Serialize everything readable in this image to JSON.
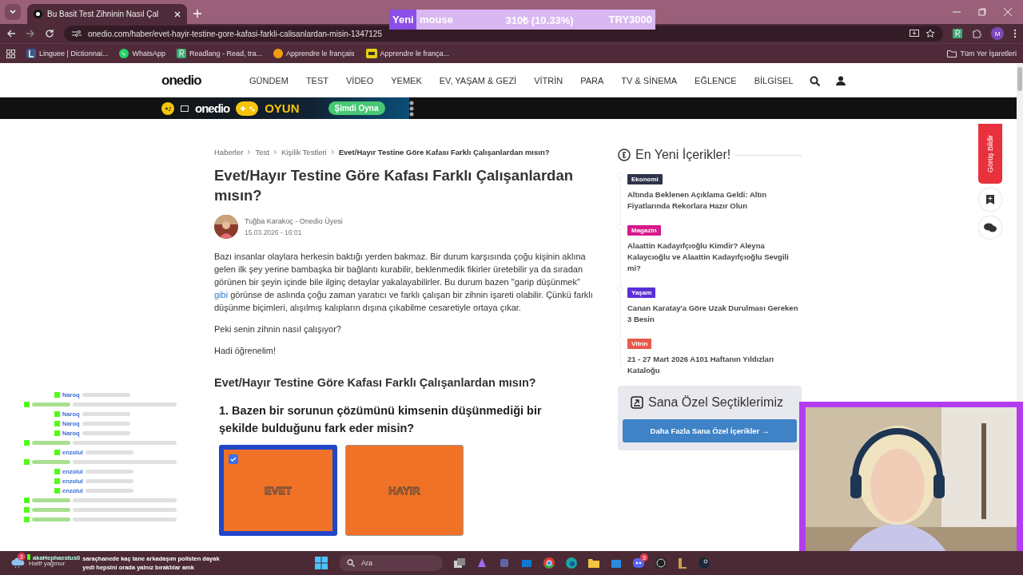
{
  "browser": {
    "tab_title": "Bu Basit Test Zihninin Nasıl Çal",
    "url": "onedio.com/haber/evet-hayir-testine-gore-kafasi-farkli-calisanlardan-misin-1347125",
    "bookmarks": [
      {
        "label": "Linguee | Dictionnai...",
        "kind": "letter"
      },
      {
        "label": "WhatsApp",
        "kind": "whatsapp"
      },
      {
        "label": "Readlang - Read, tra...",
        "kind": "r"
      },
      {
        "label": "Apprendre le français",
        "kind": "dot"
      },
      {
        "label": "Apprendre le frança...",
        "kind": "tile"
      }
    ],
    "all_bookmarks": "Tüm Yer İşaretleri",
    "profile": "M"
  },
  "goal": {
    "tag": "Yeni",
    "item": "mouse",
    "progress": "310₺ (10.33%)",
    "target": "TRY3000",
    "level": 0.1033
  },
  "site": {
    "logo": "onedio",
    "nav": [
      "GÜNDEM",
      "TEST",
      "VİDEO",
      "YEMEK",
      "EV, YAŞAM & GEZİ",
      "VİTRİN",
      "PARA",
      "TV & SİNEMA",
      "EĞLENCE",
      "BİLGİSEL"
    ],
    "promo": {
      "logo": "onedio",
      "game": "OYUN",
      "cta": "Şimdi Oyna"
    }
  },
  "article": {
    "breadcrumb": [
      "Haberler",
      "Test",
      "Kişilik Testleri",
      "Evet/Hayır Testine Göre Kafası Farklı Çalışanlardan mısın?"
    ],
    "title": "Evet/Hayır Testine Göre Kafası Farklı Çalışanlardan mısın?",
    "author": "Tuğba Karakoç - Onedio Üyesi",
    "date": "15.03.2026 - 16:01",
    "intro_before_link": "Bazı insanlar olaylara herkesin baktığı yerden bakmaz. Bir durum karşısında çoğu kişinin aklına gelen ilk şey yerine bambaşka bir bağlantı kurabilir, beklenmedik fikirler üretebilir ya da sıradan görünen bir şeyin içinde bile ilginç detaylar yakalayabilirler. Bu durum bazen \"garip düşünmek\"",
    "intro_link": "gibi",
    "intro_after_link": "görünse de aslında çoğu zaman yaratıcı ve farklı çalışan bir zihnin işareti olabilir. Çünkü farklı düşünme biçimleri, alışılmış kalıpların dışına çıkabilme cesaretiyle ortaya çıkar.",
    "paragraphs": [
      "Peki senin zihnin nasıl çalışıyor?",
      "Hadi öğrenelim!"
    ],
    "quiz_title": "Evet/Hayır Testine Göre Kafası Farklı Çalışanlardan mısın?",
    "question": "1. Bazen bir sorunun çözümünü kimsenin düşünmediği bir şekilde bulduğunu fark eder misin?",
    "options": [
      {
        "label": "EVET",
        "selected": true
      },
      {
        "label": "HAYIR",
        "selected": false
      }
    ]
  },
  "sidebar": {
    "title": "En Yeni İçerikler!",
    "items": [
      {
        "tag": "Ekonomi",
        "color": "#2d3348",
        "title": "Altında Beklenen Açıklama Geldi: Altın Fiyatlarında Rekorlara Hazır Olun"
      },
      {
        "tag": "Magazin",
        "color": "#d6198a",
        "title": "Alaattin Kadayıfçıoğlu Kimdir? Aleyna Kalaycıoğlu ve Alaattin Kadayıfçıoğlu Sevgili mi?"
      },
      {
        "tag": "Yaşam",
        "color": "#5b2fd6",
        "title": "Canan Karatay'a Göre Uzak Durulması Gereken 3 Besin"
      },
      {
        "tag": "Vitrin",
        "color": "#e8594a",
        "title": "21 - 27 Mart 2026 A101 Haftanın Yıldızları Kataloğu"
      }
    ],
    "picks_title": "Sana Özel Seçtiklerimiz",
    "picks_button": "Daha Fazla Sana Özel İçerikler",
    "picks_arrow": "→",
    "feedback": "Görüş Bildir"
  },
  "chat": [
    {
      "kind": "named",
      "user": "Naroq"
    },
    {
      "kind": "blurred"
    },
    {
      "kind": "named",
      "user": "Naroq"
    },
    {
      "kind": "named",
      "user": "Naroq"
    },
    {
      "kind": "named",
      "user": "Naroq"
    },
    {
      "kind": "blurred"
    },
    {
      "kind": "named",
      "user": "enzolul"
    },
    {
      "kind": "blurred"
    },
    {
      "kind": "named",
      "user": "enzolul"
    },
    {
      "kind": "named",
      "user": "enzolul"
    },
    {
      "kind": "named",
      "user": "enzolul"
    },
    {
      "kind": "blurred"
    },
    {
      "kind": "blurred"
    },
    {
      "kind": "blurred"
    }
  ],
  "chat_last": {
    "user": "akaHephaestus0",
    "message": "saraçhanede kaç tane arkadaşım polisten dayak yedi hepsini orada yalnız bıraktılar amk"
  },
  "taskbar": {
    "weather": "Hafif yağmur",
    "weather_badge": "2",
    "search": "Ara",
    "discord_badge": "3"
  }
}
